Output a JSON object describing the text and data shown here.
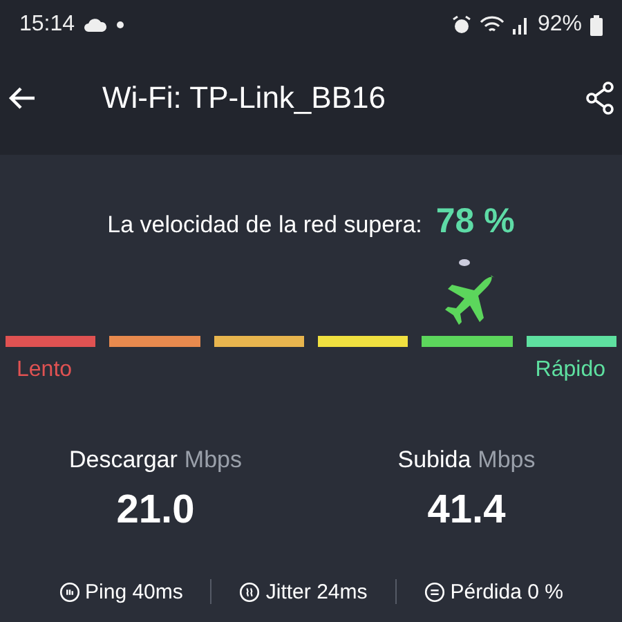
{
  "status_bar": {
    "time": "15:14",
    "battery": "92%"
  },
  "header": {
    "title": "Wi-Fi: TP-Link_BB16"
  },
  "speed": {
    "caption": "La velocidad de la red supera:",
    "percent": "78 %",
    "segments": [
      {
        "color": "#e05252",
        "selected": false
      },
      {
        "color": "#e88a4e",
        "selected": false
      },
      {
        "color": "#e8b54e",
        "selected": false
      },
      {
        "color": "#f0e040",
        "selected": false
      },
      {
        "color": "#5cd65c",
        "selected": true
      },
      {
        "color": "#5ee0a0",
        "selected": false
      }
    ],
    "slow_label": "Lento",
    "fast_label": "Rápido"
  },
  "stats": [
    {
      "label": "Descargar",
      "unit": "Mbps",
      "value": "21.0"
    },
    {
      "label": "Subida",
      "unit": "Mbps",
      "value": "41.4"
    }
  ],
  "footer": [
    {
      "kind": "ping",
      "text": "Ping 40ms"
    },
    {
      "kind": "jitter",
      "text": "Jitter 24ms"
    },
    {
      "kind": "loss",
      "text": "Pérdida 0 %"
    }
  ]
}
